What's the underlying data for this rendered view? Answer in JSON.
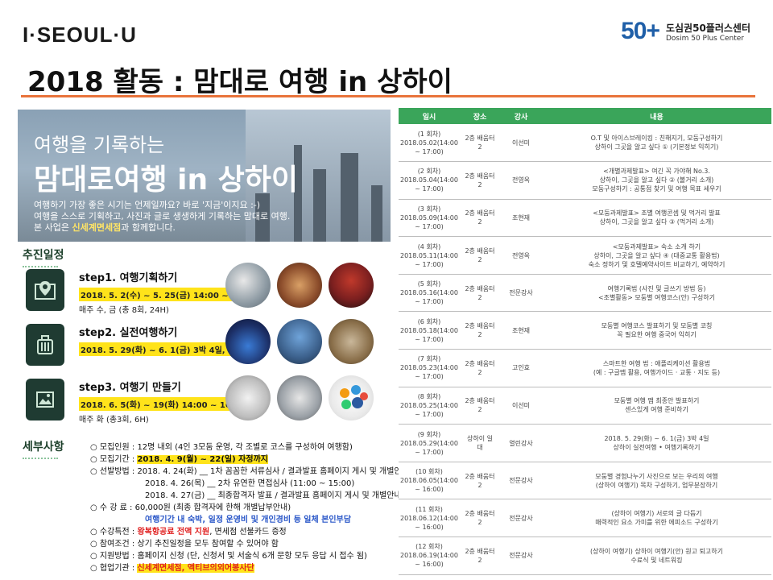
{
  "header": {
    "brand": "I·SEOUL·U",
    "partner_logo": "50+",
    "partner_name": "도심권50플러스센터",
    "partner_en": "Dosim 50 Plus Center",
    "title": "2018 활동 : 맘대로 여행 in 상하이"
  },
  "banner": {
    "line1": "여행을 기록하는",
    "line2": "맘대로여행 in 상하이",
    "desc1": "여행하기 가장 좋은 시기는 언제일까요? 바로 '지금'이지요 :-)",
    "desc2": "여행을 스스로 기획하고, 사진과 글로 생생하게 기록하는 맘대로 여행.",
    "desc3_pre": "본 사업은 ",
    "desc3_hl": "신세계면세점",
    "desc3_post": "과 함께합니다."
  },
  "schedule_section": {
    "title": "추진일정",
    "steps": [
      {
        "name": "step1. 여행기획하기",
        "date": "2018. 5. 2(수) ~ 5. 25(금) 14:00 ~ 17:00",
        "sub": "매주 수, 금 (총 8회, 24H)"
      },
      {
        "name": "step2. 실전여행하기",
        "date": "2018. 5. 29(화) ~ 6. 1(금) 3박 4일, 상하이",
        "sub": ""
      },
      {
        "name": "step3. 여행기 만들기",
        "date": "2018. 6. 5(화) ~ 19(화) 14:00 ~ 16:00",
        "sub": "매주 화 (총3회, 6H)"
      }
    ]
  },
  "details_section": {
    "title": "세부사항",
    "items": [
      {
        "label": "○ 모집인원 : ",
        "text": "12명 내외 (4인 3모둠 운영, 각 조별로 코스를 구성하여 여행함)"
      },
      {
        "label": "○ 모집기간 : ",
        "text": "2018. 4. 9(월) ~ 22(일) 자정까지"
      },
      {
        "label": "○ 선발방법 : ",
        "text": "2018. 4. 24(화) __ 1차 꼼꼼한 서류심사 / 결과발표 홈페이지 게시 및 개별안내"
      },
      {
        "label": "",
        "text": "2018. 4. 26(목) __ 2차 유연한 면접심사 (11:00 ~ 15:00)"
      },
      {
        "label": "",
        "text": "2018. 4. 27(금) __ 최종합격자 발표 / 결과발표 홈페이지 게시 및 개별안내"
      },
      {
        "label": "○ 수 강 료 : ",
        "text": "60,000원 (최종 합격자에 한해 개별납부안내)"
      },
      {
        "label": "",
        "text": "여행기간 내 숙박, 일정 운영비 및 개인경비 등 일체 본인부담"
      },
      {
        "label": "○ 수강특전 : ",
        "text": "왕복항공료 전액 지원",
        "text2": ", 면세점 선불카드 증정"
      },
      {
        "label": "○ 참여조건 : ",
        "text": "상기 추진일정을 모두 참여할 수 있어야 함"
      },
      {
        "label": "○ 지원방법 : ",
        "text": "홈페이지 신청 (단, 신청서 및 서술식 6개 문항 모두 응답 시 접수 됨)"
      },
      {
        "label": "○ 협업기관 : ",
        "text": "신세계면세점, 액티브의외어봉사단"
      }
    ]
  },
  "table": {
    "headers": [
      "일시",
      "장소",
      "강사",
      "내용"
    ],
    "rows": [
      {
        "date": [
          "(1 회차)",
          "2018.05.02(14:00",
          "~ 17:00)"
        ],
        "place": [
          "2층 배움터",
          "2"
        ],
        "teacher": "이선미",
        "content": [
          "O.T 및 아이스브레이킹 : 친해지기, 모둠구성하기",
          "상하이 그곳을 알고 싶다 ① (기본정보 익히기)"
        ]
      },
      {
        "date": [
          "(2 회차)",
          "2018.05.04(14:00",
          "~ 17:00)"
        ],
        "place": [
          "2층 배움터",
          "2"
        ],
        "teacher": "전영옥",
        "content": [
          "<개별과제발표> 여긴 꼭 가야해 No.3.",
          "상하이, 그곳을 알고 싶다 ② (볼거리 소개)",
          "모둠구성하기 : 공통점 찾기 및 여행 목표 세우기"
        ]
      },
      {
        "date": [
          "(3 회차)",
          "2018.05.09(14:00",
          "~ 17:00)"
        ],
        "place": [
          "2층 배움터",
          "2"
        ],
        "teacher": "조현재",
        "content": [
          "<모둠과제발표> 조별 여행콘셉 및 먹거리 발표",
          "상하이, 그곳을 알고 싶다 ③ (먹거리 소개)"
        ]
      },
      {
        "date": [
          "(4 회차)",
          "2018.05.11(14:00",
          "~ 17:00)"
        ],
        "place": [
          "2층 배움터",
          "2"
        ],
        "teacher": "전영옥",
        "content": [
          "<모둠과제발표> 숙소 소개 하기",
          "상하이, 그곳을 알고 싶다 ④ (대중교통 활용법)",
          "숙소 정하기 및 호텔예약사이트 비교하기, 예약하기"
        ]
      },
      {
        "date": [
          "(5 회차)",
          "2018.05.16(14:00",
          "~ 17:00)"
        ],
        "place": [
          "2층 배움터",
          "2"
        ],
        "teacher": "전문강사",
        "content": [
          "여행기록법 (사진 및 글쓰기 방법 등)",
          "<조별활동> 모둠별 여행코스(안) 구성하기"
        ]
      },
      {
        "date": [
          "(6 회차)",
          "2018.05.18(14:00",
          "~ 17:00)"
        ],
        "place": [
          "2층 배움터",
          "2"
        ],
        "teacher": "조현재",
        "content": [
          "모둠별 여행코스 발표하기 및 모둠별 코칭",
          "꼭 필요한 여행 중국어 익히기"
        ]
      },
      {
        "date": [
          "(7 회차)",
          "2018.05.23(14:00",
          "~ 17:00)"
        ],
        "place": [
          "2층 배움터",
          "2"
        ],
        "teacher": "고인효",
        "content": [
          "스마트한 여행 법 : 애플리케이션 활용법",
          "(예 : 구글맵 활용, 여행가이드 · 교통 · 지도 등)"
        ]
      },
      {
        "date": [
          "(8 회차)",
          "2018.05.25(14:00",
          "~ 17:00)"
        ],
        "place": [
          "2층 배움터",
          "2"
        ],
        "teacher": "이선미",
        "content": [
          "모둠별 여행 맵 최종안 발표하기",
          "센스있게 여행 준비하기"
        ]
      },
      {
        "date": [
          "(9 회차)",
          "2018.05.29(14:00",
          "~ 17:00)"
        ],
        "place": [
          "상하이 일",
          "대"
        ],
        "teacher": "열린강사",
        "content": [
          "2018. 5. 29(화) ~ 6. 1(금) 3박 4일",
          "상하이 실전여행 • 여행기록하기"
        ]
      },
      {
        "date": [
          "(10 회차)",
          "2018.06.05(14:00",
          "~ 16:00)"
        ],
        "place": [
          "2층 배움터",
          "2"
        ],
        "teacher": "전문강사",
        "content": [
          "모둠별 경험나누기 사진으로 보는 우리의 여행",
          "(상하이 여행기) 목차 구성하기, 업무분장하기"
        ]
      },
      {
        "date": [
          "(11 회차)",
          "2018.06.12(14:00",
          "~ 16:00)"
        ],
        "place": [
          "2층 배움터",
          "2"
        ],
        "teacher": "전문강사",
        "content": [
          "(상하이 여행기) 서로의 글 다듬기",
          "매력적인 요소 가미를 위한 에피소드 구성하기"
        ]
      },
      {
        "date": [
          "(12 회차)",
          "2018.06.19(14:00",
          "~ 16:00)"
        ],
        "place": [
          "2층 배움터",
          "2"
        ],
        "teacher": "전문강사",
        "content": [
          "(상하이 여행기) 상하이 여행기(안) 원고 퇴고하기",
          "수료식 및 네트워킹"
        ]
      }
    ]
  }
}
